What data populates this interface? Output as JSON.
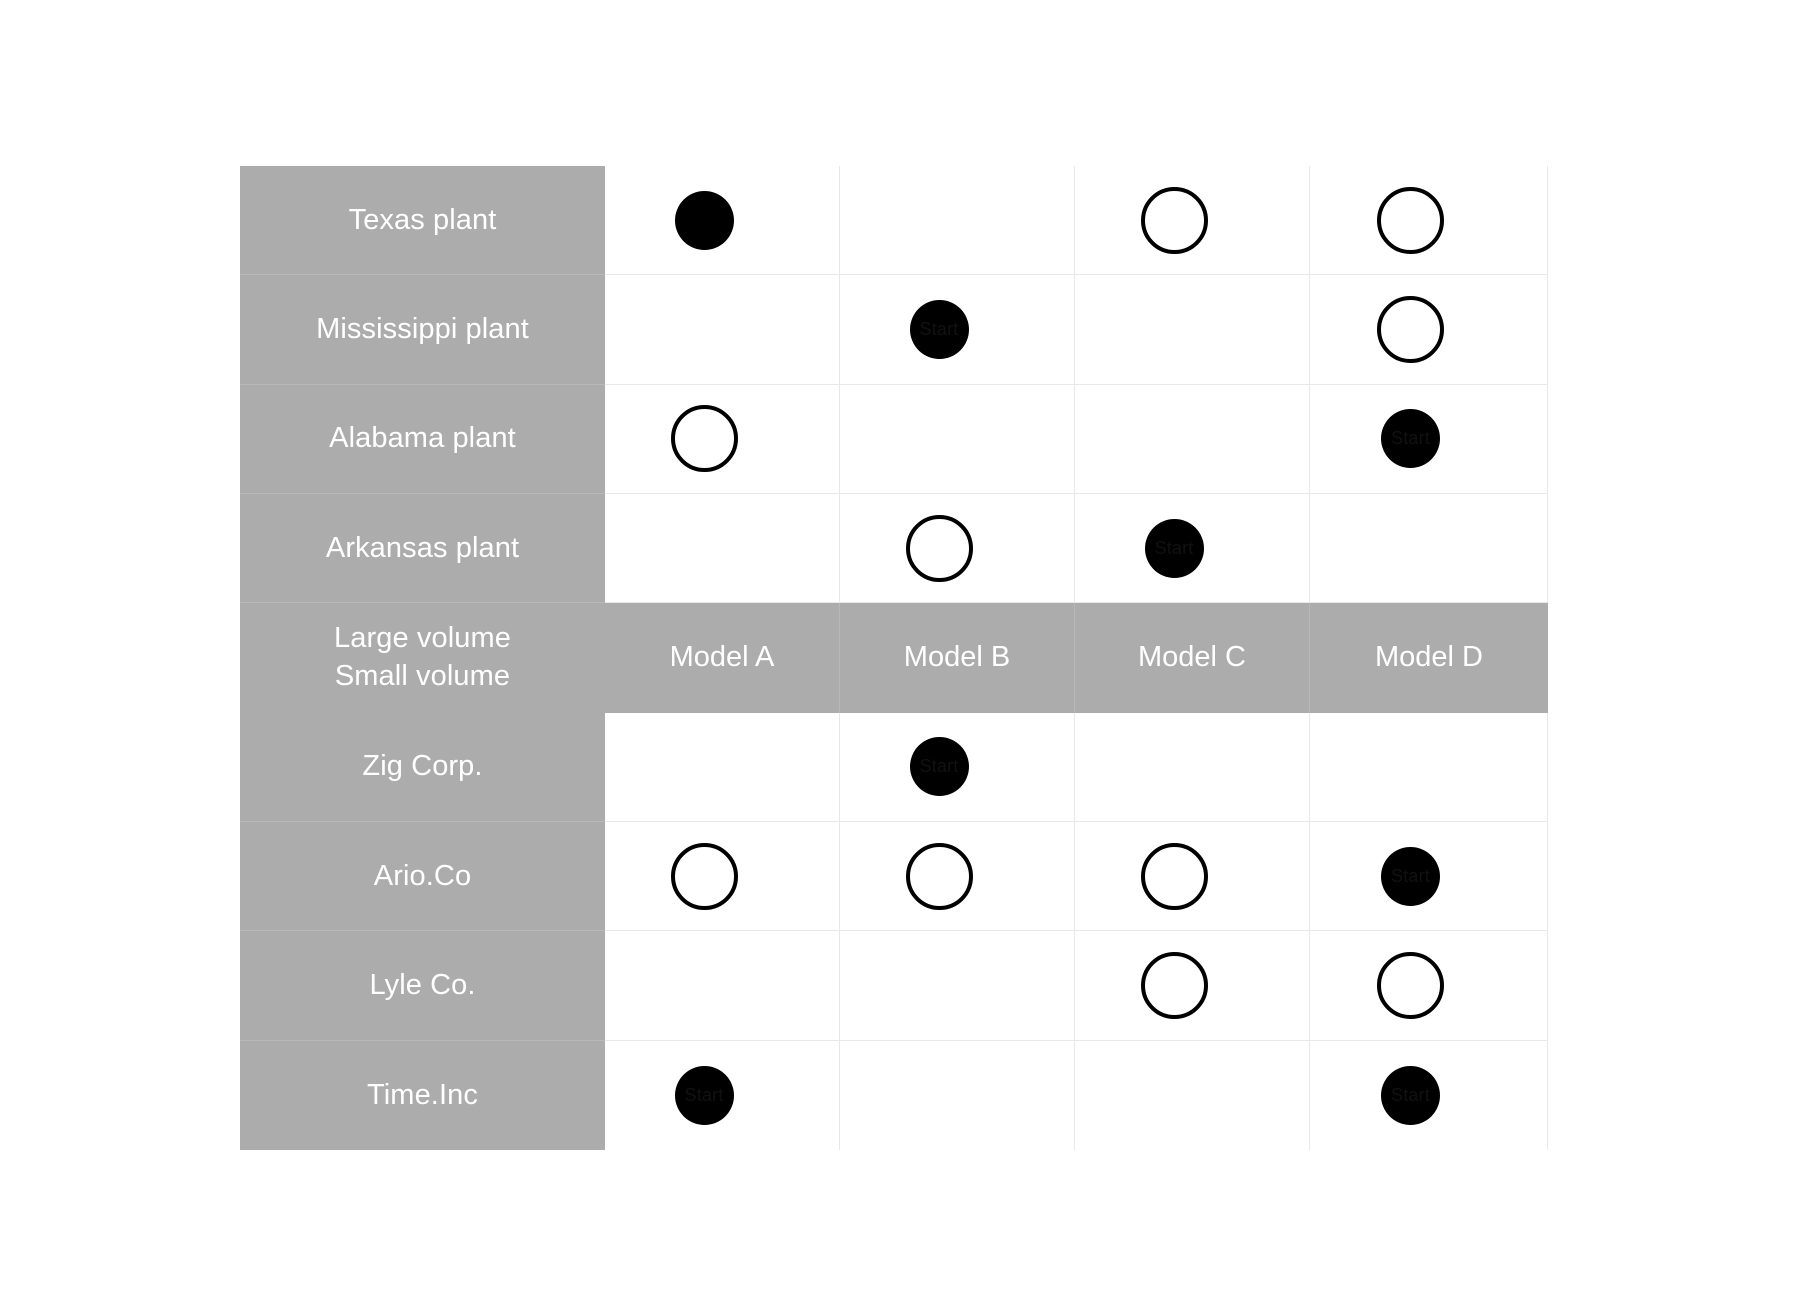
{
  "matrix": {
    "colors": {
      "header_gray": "#ACACAC",
      "grid_line": "#E8E8E8",
      "marker_fill": "#000000",
      "background": "#FFFFFF"
    },
    "column_headers": [
      "Model A",
      "Model B",
      "Model C",
      "Model D"
    ],
    "header_row_label": {
      "line1": "Large volume",
      "line2": "Small volume"
    },
    "marker_start_label": "Start",
    "top_section_rows": [
      {
        "label": "Texas plant",
        "cells": [
          {
            "marker": "filled",
            "label": ""
          },
          {
            "marker": "none",
            "label": ""
          },
          {
            "marker": "open",
            "label": ""
          },
          {
            "marker": "open",
            "label": ""
          }
        ]
      },
      {
        "label": "Mississippi plant",
        "cells": [
          {
            "marker": "none",
            "label": ""
          },
          {
            "marker": "filled",
            "label": "Start"
          },
          {
            "marker": "none",
            "label": ""
          },
          {
            "marker": "open",
            "label": ""
          }
        ]
      },
      {
        "label": "Alabama plant",
        "cells": [
          {
            "marker": "open",
            "label": ""
          },
          {
            "marker": "none",
            "label": ""
          },
          {
            "marker": "none",
            "label": ""
          },
          {
            "marker": "filled",
            "label": "Start"
          }
        ]
      },
      {
        "label": "Arkansas plant",
        "cells": [
          {
            "marker": "none",
            "label": ""
          },
          {
            "marker": "open",
            "label": ""
          },
          {
            "marker": "filled",
            "label": "Start"
          },
          {
            "marker": "none",
            "label": ""
          }
        ]
      }
    ],
    "bottom_section_rows": [
      {
        "label": "Zig Corp.",
        "cells": [
          {
            "marker": "none",
            "label": ""
          },
          {
            "marker": "filled",
            "label": "Start"
          },
          {
            "marker": "none",
            "label": ""
          },
          {
            "marker": "none",
            "label": ""
          }
        ]
      },
      {
        "label": "Ario.Co",
        "cells": [
          {
            "marker": "open",
            "label": ""
          },
          {
            "marker": "open",
            "label": ""
          },
          {
            "marker": "open",
            "label": ""
          },
          {
            "marker": "filled",
            "label": "Start"
          }
        ]
      },
      {
        "label": "Lyle Co.",
        "cells": [
          {
            "marker": "none",
            "label": ""
          },
          {
            "marker": "none",
            "label": ""
          },
          {
            "marker": "open",
            "label": ""
          },
          {
            "marker": "open",
            "label": ""
          }
        ]
      },
      {
        "label": "Time.Inc",
        "cells": [
          {
            "marker": "filled",
            "label": "Start"
          },
          {
            "marker": "none",
            "label": ""
          },
          {
            "marker": "none",
            "label": ""
          },
          {
            "marker": "filled",
            "label": "Start"
          }
        ]
      }
    ]
  }
}
